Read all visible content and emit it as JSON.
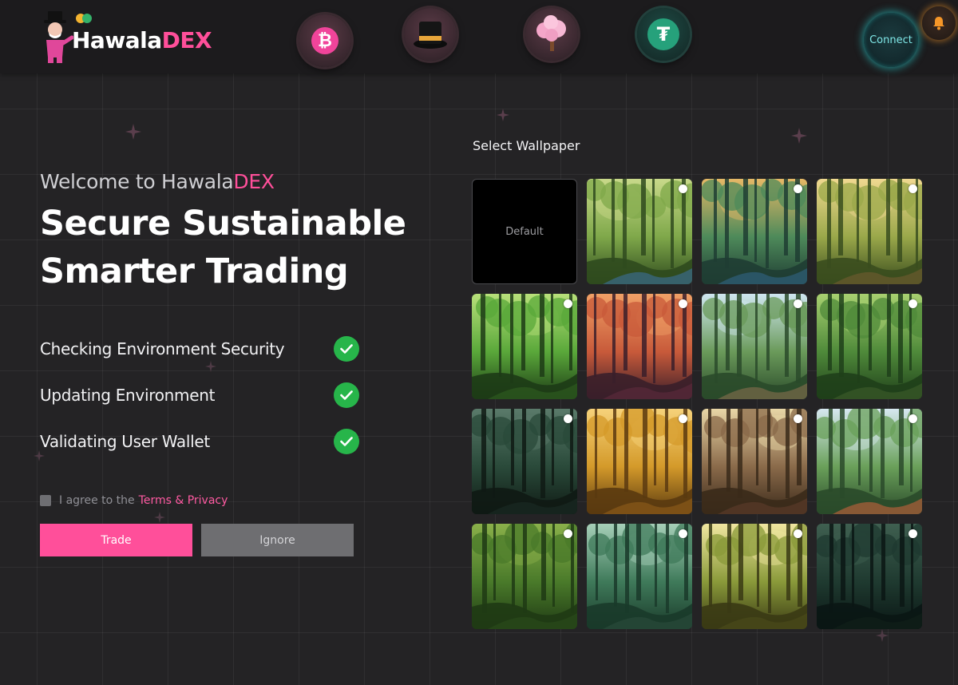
{
  "header": {
    "brand_prefix": "Hawala",
    "brand_suffix": "DEX",
    "coins": [
      {
        "name": "bitcoin",
        "glyph": "₿",
        "color": "#f0449a"
      },
      {
        "name": "top-hat",
        "color": "#111111"
      },
      {
        "name": "blossom-tree",
        "color": "#f4a6c9"
      },
      {
        "name": "tether",
        "glyph": "₮",
        "color": "#26a17b"
      }
    ],
    "connect_label": "Connect",
    "bell_icon": "bell-icon"
  },
  "hero": {
    "welcome_prefix": "Welcome to Hawala",
    "welcome_suffix": "DEX",
    "headline_line1": "Secure Sustainable",
    "headline_line2": "Smarter Trading"
  },
  "checks": [
    {
      "label": "Checking Environment Security",
      "status": "done"
    },
    {
      "label": "Updating Environment",
      "status": "done"
    },
    {
      "label": "Validating User Wallet",
      "status": "done"
    }
  ],
  "agreement": {
    "text": "I agree to the",
    "link": "Terms & Privacy",
    "checked": false
  },
  "buttons": {
    "trade": "Trade",
    "ignore": "Ignore"
  },
  "wallpapers": {
    "title": "Select Wallpaper",
    "default_label": "Default",
    "items": [
      {
        "name": "forest-stream",
        "selected": false
      },
      {
        "name": "forest-glow-mushrooms",
        "selected": false
      },
      {
        "name": "forest-sunbeams",
        "selected": false
      },
      {
        "name": "green-forest-path",
        "selected": false
      },
      {
        "name": "sunset-forest",
        "selected": false
      },
      {
        "name": "forest-clearing",
        "selected": false
      },
      {
        "name": "tall-green-forest",
        "selected": false
      },
      {
        "name": "dark-forest-path",
        "selected": false
      },
      {
        "name": "autumn-forest",
        "selected": false
      },
      {
        "name": "autumn-sunrays",
        "selected": false
      },
      {
        "name": "forest-meadow-flowers",
        "selected": false
      },
      {
        "name": "twisted-trees",
        "selected": false
      },
      {
        "name": "misty-forest",
        "selected": false
      },
      {
        "name": "golden-light-forest",
        "selected": false
      },
      {
        "name": "night-forest",
        "selected": false
      }
    ]
  },
  "colors": {
    "accent": "#ff4f9a",
    "success": "#27b54a",
    "background": "#242325",
    "header": "#1c1b1d",
    "connect_glow": "#28dcdc",
    "bell_glow": "#f59628"
  }
}
